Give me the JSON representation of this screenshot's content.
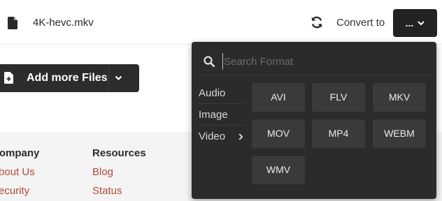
{
  "file": {
    "name": "4K-hevc.mkv",
    "icon": "file-icon"
  },
  "toolbar": {
    "refresh_icon": "refresh-icon",
    "convert_label": "Convert to",
    "select_value": "...",
    "select_icon": "chevron-down-icon"
  },
  "add_files": {
    "label": "Add more Files",
    "icon": "file-plus-icon",
    "dropdown_icon": "chevron-down-icon"
  },
  "footer": {
    "columns": [
      {
        "heading": "Company",
        "links": [
          "About Us",
          "Security"
        ]
      },
      {
        "heading": "Resources",
        "links": [
          "Blog",
          "Status"
        ]
      }
    ]
  },
  "dropdown": {
    "search": {
      "placeholder": "Search Format",
      "value": "",
      "icon": "search-icon"
    },
    "categories": [
      {
        "label": "Audio",
        "active": false
      },
      {
        "label": "Image",
        "active": false
      },
      {
        "label": "Video",
        "active": true
      }
    ],
    "formats": [
      "AVI",
      "FLV",
      "MKV",
      "MOV",
      "MP4",
      "WEBM",
      "WMV"
    ]
  },
  "colors": {
    "panel_bg": "#2b2b2b",
    "button_bg": "#3a3a3a",
    "link_color": "#b04a3b",
    "footer_bg": "#f4f4f4"
  }
}
